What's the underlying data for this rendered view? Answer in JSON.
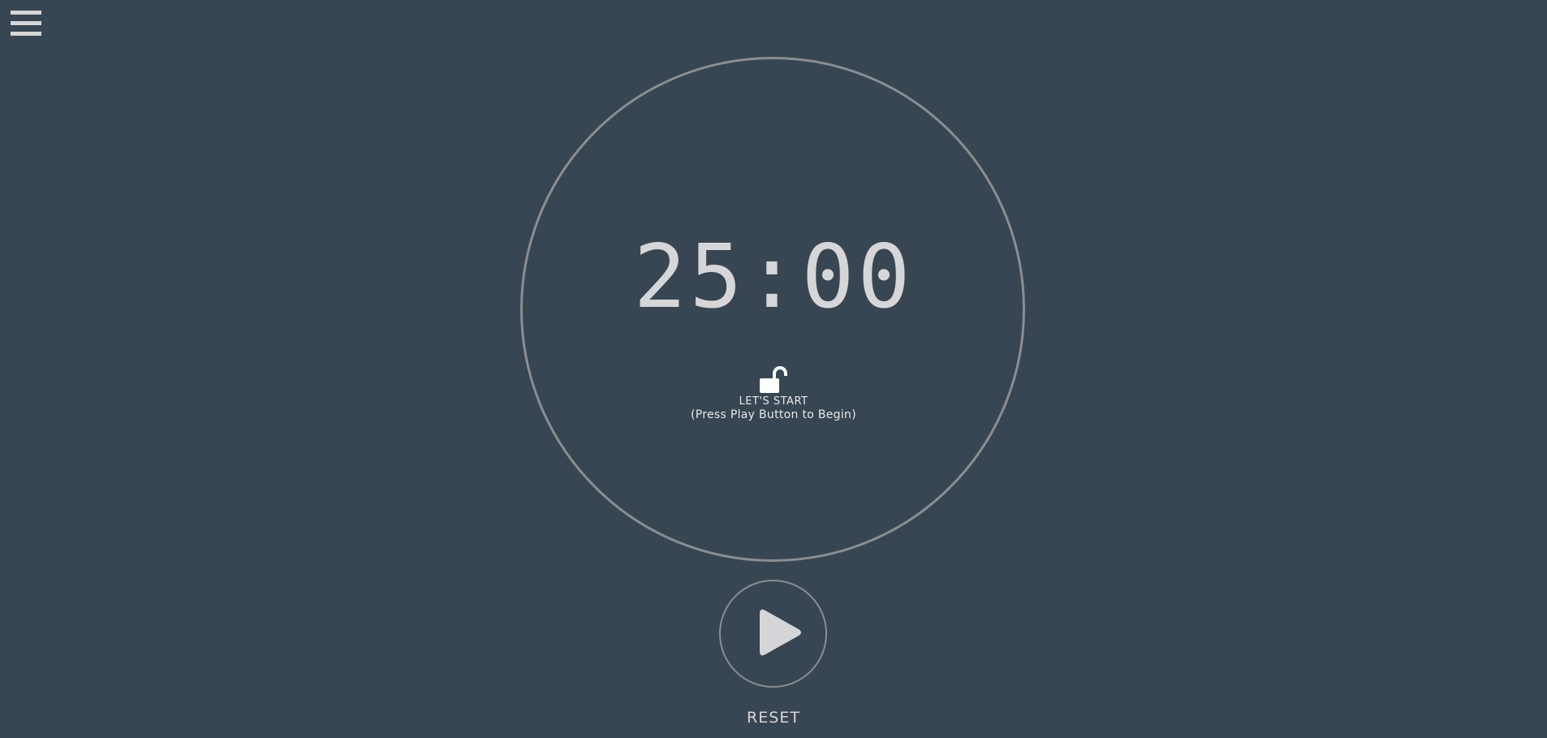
{
  "menu": {
    "icon": "hamburger-menu-icon"
  },
  "timer": {
    "time": "25:00",
    "lock_icon": "unlocked-padlock-icon",
    "status": "LET'S START",
    "hint": "(Press Play Button to Begin)"
  },
  "controls": {
    "play_icon": "play-icon",
    "reset_label": "RESET"
  },
  "colors": {
    "background": "#384552",
    "ring": "#8a8e92",
    "text": "#d6d6d8"
  }
}
